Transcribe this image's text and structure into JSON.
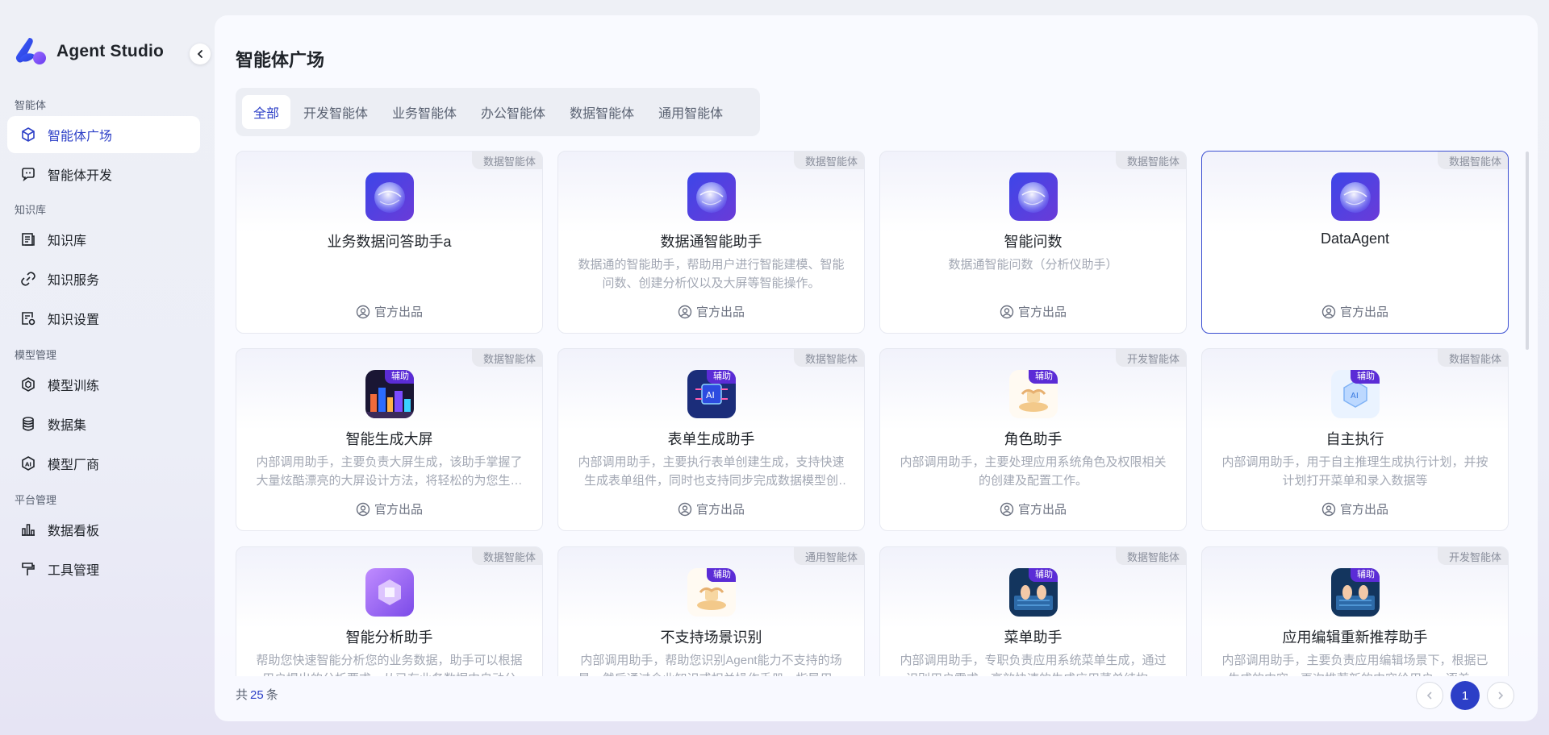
{
  "brand": {
    "name": "Agent Studio"
  },
  "sidebar": {
    "groups": [
      {
        "title": "智能体",
        "items": [
          {
            "label": "智能体广场",
            "icon": "cube-icon",
            "active": true
          },
          {
            "label": "智能体开发",
            "icon": "chat-bubble-icon"
          }
        ]
      },
      {
        "title": "知识库",
        "items": [
          {
            "label": "知识库",
            "icon": "book-icon"
          },
          {
            "label": "知识服务",
            "icon": "link-icon"
          },
          {
            "label": "知识设置",
            "icon": "settings-doc-icon"
          }
        ]
      },
      {
        "title": "模型管理",
        "items": [
          {
            "label": "模型训练",
            "icon": "box-icon"
          },
          {
            "label": "数据集",
            "icon": "database-icon"
          },
          {
            "label": "模型厂商",
            "icon": "ai-badge-icon"
          }
        ]
      },
      {
        "title": "平台管理",
        "items": [
          {
            "label": "数据看板",
            "icon": "bar-chart-icon"
          },
          {
            "label": "工具管理",
            "icon": "hammer-icon"
          }
        ]
      }
    ]
  },
  "page": {
    "title": "智能体广场"
  },
  "tabs": [
    "全部",
    "开发智能体",
    "业务智能体",
    "办公智能体",
    "数据智能体",
    "通用智能体"
  ],
  "cards": [
    {
      "name": "业务数据问答助手a",
      "tag": "数据智能体",
      "desc": "",
      "author": "官方出品",
      "avatar": "sphere",
      "badge": ""
    },
    {
      "name": "数据通智能助手",
      "tag": "数据智能体",
      "desc": "数据通的智能助手，帮助用户进行智能建模、智能问数、创建分析仪以及大屏等智能操作。",
      "author": "官方出品",
      "avatar": "sphere",
      "badge": ""
    },
    {
      "name": "智能问数",
      "tag": "数据智能体",
      "desc": "数据通智能问数（分析仪助手）",
      "author": "官方出品",
      "avatar": "sphere",
      "badge": ""
    },
    {
      "name": "DataAgent",
      "tag": "数据智能体",
      "desc": "",
      "author": "官方出品",
      "avatar": "sphere",
      "badge": "",
      "selected": true
    },
    {
      "name": "智能生成大屏",
      "tag": "数据智能体",
      "desc": "内部调用助手，主要负责大屏生成，该助手掌握了大量炫酷漂亮的大屏设计方法，将轻松的为您生成大屏。",
      "author": "官方出品",
      "avatar": "city",
      "badge": "辅助"
    },
    {
      "name": "表单生成助手",
      "tag": "数据智能体",
      "desc": "内部调用助手，主要执行表单创建生成，支持快速生成表单组件，同时也支持同步完成数据模型创建。",
      "author": "官方出品",
      "avatar": "chip",
      "badge": "辅助"
    },
    {
      "name": "角色助手",
      "tag": "开发智能体",
      "desc": "内部调用助手，主要处理应用系统角色及权限相关的创建及配置工作。",
      "author": "官方出品",
      "avatar": "hand",
      "badge": "辅助"
    },
    {
      "name": "自主执行",
      "tag": "数据智能体",
      "desc": "内部调用助手，用于自主推理生成执行计划，并按计划打开菜单和录入数据等",
      "author": "官方出品",
      "avatar": "ai-cube",
      "badge": "辅助"
    },
    {
      "name": "智能分析助手",
      "tag": "数据智能体",
      "desc": "帮助您快速智能分析您的业务数据，助手可以根据用户提出的分析要求，从已有业务数据中自动分析。",
      "author": "官方出品",
      "avatar": "purple",
      "badge": ""
    },
    {
      "name": "不支持场景识别",
      "tag": "通用智能体",
      "desc": "内部调用助手，帮助您识别Agent能力不支持的场景，然后通过企业知识或相关操作手册，指导用户完成。",
      "author": "官方出品",
      "avatar": "hand",
      "badge": "辅助"
    },
    {
      "name": "菜单助手",
      "tag": "数据智能体",
      "desc": "内部调用助手，专职负责应用系统菜单生成，通过识别用户需求，高效快速的生成应用菜单结构。",
      "author": "官方出品",
      "avatar": "keyboard",
      "badge": "辅助"
    },
    {
      "name": "应用编辑重新推荐助手",
      "tag": "开发智能体",
      "desc": "内部调用助手，主要负责应用编辑场景下，根据已生成的内容，再次推荐新的内容给用户，逐差。",
      "author": "官方出品",
      "avatar": "keyboard",
      "badge": "辅助"
    }
  ],
  "footer": {
    "total_prefix": "共",
    "total": "25",
    "total_suffix": "条",
    "current_page": "1"
  },
  "colors": {
    "accent": "#2c3fc7",
    "badge": "#5b2cd6"
  }
}
